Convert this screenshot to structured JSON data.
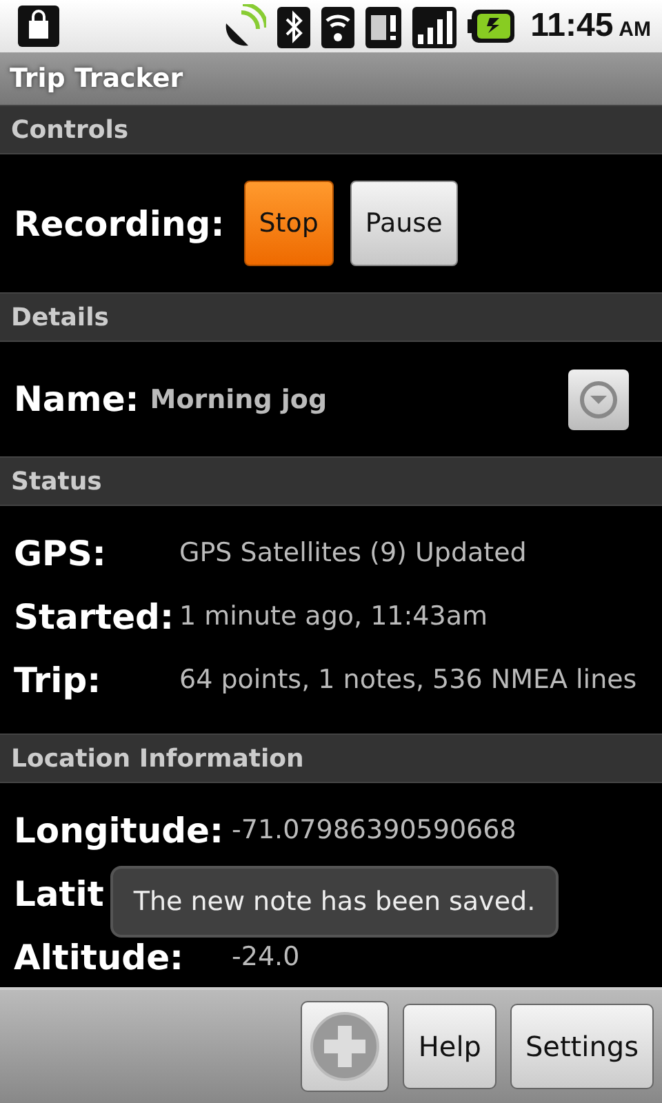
{
  "status_bar": {
    "time": "11:45",
    "ampm": "AM"
  },
  "title_bar": {
    "title": "Trip Tracker"
  },
  "sections": [
    {
      "header": "Controls",
      "kind": "controls",
      "label": "Recording:",
      "buttons": [
        {
          "label": "Stop",
          "selected": true
        },
        {
          "label": "Pause",
          "selected": false
        }
      ]
    },
    {
      "header": "Details",
      "kind": "name",
      "label": "Name:",
      "value": "Morning jog"
    },
    {
      "header": "Status",
      "kind": "fields",
      "rows": [
        {
          "label": "GPS:",
          "value": "GPS Satellites (9) Updated"
        },
        {
          "label": "Started:",
          "value": "1 minute ago, 11:43am"
        },
        {
          "label": "Trip:",
          "value": "64 points, 1 notes, 536 NMEA lines"
        }
      ]
    },
    {
      "header": "Location Information",
      "kind": "fields",
      "rows": [
        {
          "label": "Longitude:",
          "value": "-71.07986390590668"
        },
        {
          "label": "Latit"
        },
        {
          "label": "Altitude:",
          "value": "-24.0"
        }
      ]
    }
  ],
  "toast": "The new note has been saved.",
  "bottom_bar": {
    "buttons": [
      {
        "kind": "add"
      },
      {
        "kind": "text",
        "label": "Help"
      },
      {
        "kind": "text",
        "label": "Settings"
      }
    ]
  }
}
